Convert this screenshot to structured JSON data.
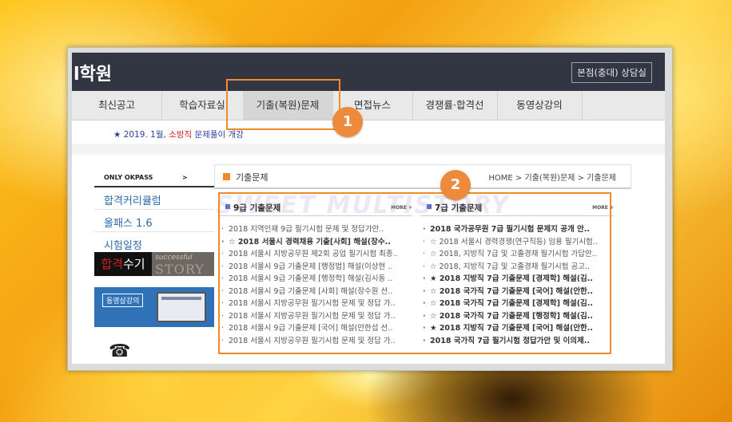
{
  "header": {
    "logo": "l학원",
    "consult_button": "본점(충대) 상담실"
  },
  "nav": {
    "items": [
      {
        "label": "최신공고"
      },
      {
        "label": "학습자료실"
      },
      {
        "label": "기출(복원)문제"
      },
      {
        "label": "면접뉴스"
      },
      {
        "label": "경쟁률·합격선"
      },
      {
        "label": "동영상강의"
      }
    ]
  },
  "notice": {
    "prefix": "★ 2019. 1월, ",
    "highlight": "소방직",
    "suffix": " 문제풀이 개강"
  },
  "left": {
    "okpass": "ONLY OKPASS",
    "okpass_arrow": ">",
    "menu": [
      "합격커리큘럼",
      "올패스 1.6",
      "시험일정"
    ],
    "banner1": {
      "main_a": "합격",
      "main_b": "수기",
      "sub1": "successful",
      "sub2": "STORY"
    },
    "banner2": {
      "label": "동영상강의"
    },
    "phone_icon": "phone-icon"
  },
  "section": {
    "title": "기출문제",
    "breadcrumb": "HOME > 기출(복원)문제 > 기출문제"
  },
  "col9": {
    "title": "9급 기출문제",
    "more": "MORE +",
    "rows": [
      {
        "text": "2018 지역인재 9급 필기시험 문제 및 정답가안..",
        "bold": false
      },
      {
        "text": "☆ 2018 서울시 경력채용 기출[사회] 해설(장수..",
        "bold": true
      },
      {
        "text": "2018 서울시 지방공무원 제2회 공업 필기시험 최종..",
        "bold": false
      },
      {
        "text": "2018 서울시 9급 기출문제 [행정법] 해설(이상현 ..",
        "bold": false
      },
      {
        "text": "2018 서울시 9급 기출문제 [행정학] 해설(김시동 ..",
        "bold": false
      },
      {
        "text": "2018 서울시 9급 기출문제 [사회] 해설(장수원 선..",
        "bold": false
      },
      {
        "text": "2018 서울시 지방공무원 필기시험 문제 및 정답 가..",
        "bold": false
      },
      {
        "text": "2018 서울시 지방공무원 필기시험 문제 및 정답 가..",
        "bold": false
      },
      {
        "text": "2018 서울시 9급 기출문제 [국어] 해설(안한섭 선..",
        "bold": false
      },
      {
        "text": "2018 서울시 지방공무원 필기시험 문제 및 정답 가..",
        "bold": false
      }
    ]
  },
  "col7": {
    "title": "7급 기출문제",
    "more": "MORE +",
    "rows": [
      {
        "text": "2018 국가공무원 7급 필기시험 문제지 공개 안..",
        "bold": true
      },
      {
        "text": "☆ 2018 서울시 경력경쟁(연구직등) 임용 필기시험..",
        "bold": false
      },
      {
        "text": "☆ 2018, 지방직 7급 및 고졸경채 필기시험 가답안..",
        "bold": false
      },
      {
        "text": "☆ 2018, 지방직 7급 및 고졸경채 필기시험 공고..",
        "bold": false
      },
      {
        "text": "★ 2018 지방직 7급 기출문제 [경제학] 해설(김..",
        "bold": true
      },
      {
        "text": "☆ 2018 국가직 7급 기출문제 [국어] 해설(안한..",
        "bold": true
      },
      {
        "text": "☆ 2018 국가직 7급 기출문제 [경제학] 해설(김..",
        "bold": true
      },
      {
        "text": "☆ 2018 국가직 7급 기출문제 [행정학] 해설(김..",
        "bold": true
      },
      {
        "text": "★ 2018 지방직 7급 기출문제 [국어] 해설(안한..",
        "bold": true
      },
      {
        "text": "2018 국가직 7급 필기시험 정답가안 및 이의제..",
        "bold": true
      }
    ]
  },
  "callouts": [
    "1",
    "2"
  ],
  "watermark": "SWEET MULTISTORY"
}
